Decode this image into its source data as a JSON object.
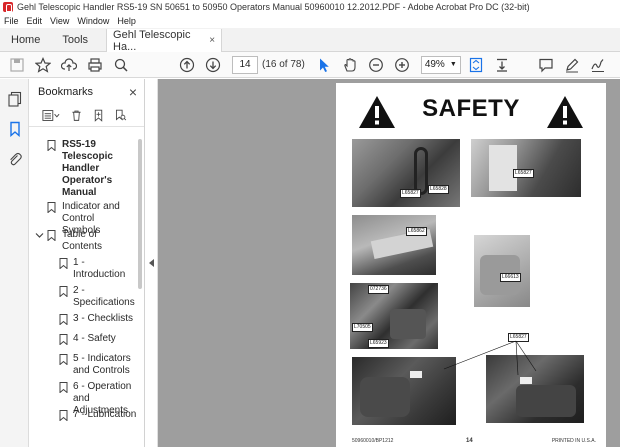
{
  "window": {
    "title": "Gehl Telescopic Handler RS5-19 SN 50651 to 50950 Operators Manual 50960010 12.2012.PDF - Adobe Acrobat Pro DC (32-bit)"
  },
  "menu": [
    "File",
    "Edit",
    "View",
    "Window",
    "Help"
  ],
  "tabs": {
    "home": "Home",
    "tools": "Tools",
    "document": "Gehl Telescopic Ha...",
    "close": "×"
  },
  "toolbar": {
    "page_number": "14",
    "page_count": "(16 of 78)",
    "zoom": "49%"
  },
  "bookmarks": {
    "title": "Bookmarks",
    "close": "×",
    "items": [
      {
        "label": "RS5-19 Telescopic Handler Operator's Manual",
        "bold": true,
        "level": 0
      },
      {
        "label": "Indicator and Control Symbols",
        "bold": false,
        "level": 0
      },
      {
        "label": "Table of Contents",
        "bold": false,
        "level": 0,
        "expanded": true
      },
      {
        "label": "1 - Introduction",
        "level": 1
      },
      {
        "label": "2 - Specifications",
        "level": 1
      },
      {
        "label": "3 - Checklists",
        "level": 1
      },
      {
        "label": "4 - Safety",
        "level": 1
      },
      {
        "label": "5 - Indicators and Controls",
        "level": 1
      },
      {
        "label": "6 - Operation and Adjustments",
        "level": 1
      },
      {
        "label": "7 - Lubrication",
        "level": 1
      }
    ]
  },
  "pdf_page": {
    "title": "SAFETY",
    "labels": {
      "l1a": "L65827",
      "l1b": "L65828",
      "l2": "L65827",
      "l3": "L65862",
      "l4": "L66613",
      "l5a": "072736",
      "l5b": "L70505",
      "l5c": "L65923",
      "l6": "L65827"
    },
    "footer_left": "50960010/BP1212",
    "footer_center": "14",
    "footer_right": "PRINTED IN U.S.A."
  }
}
